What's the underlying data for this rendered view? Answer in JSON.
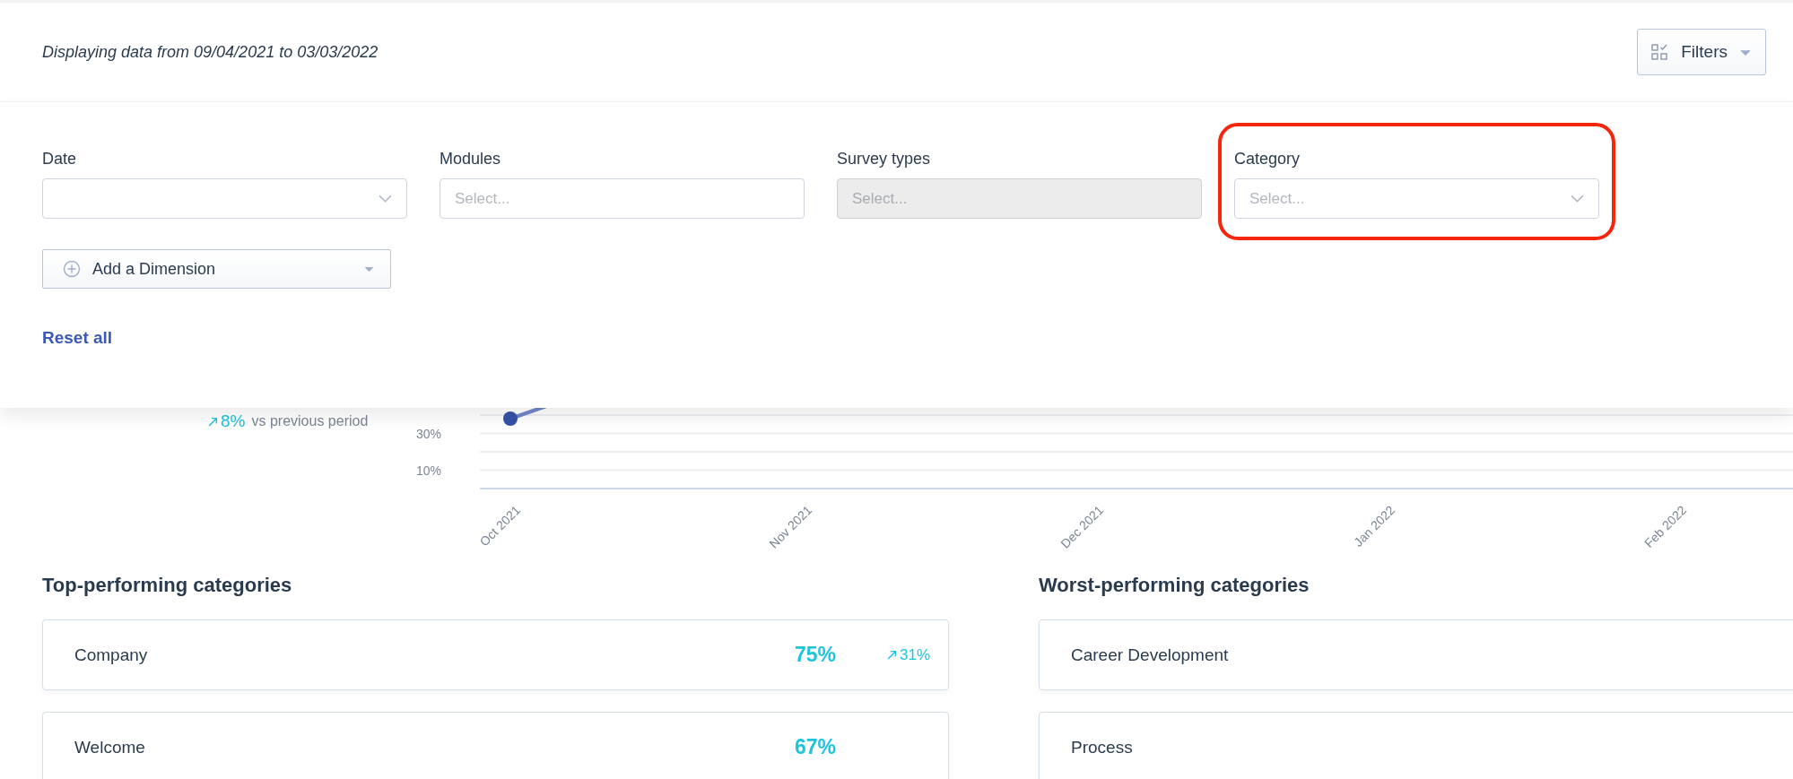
{
  "header": {
    "date_range": "Displaying data from 09/04/2021 to 03/03/2022",
    "filters_button": "Filters"
  },
  "filter_panel": {
    "fields": [
      {
        "label": "Date",
        "kind": "dropdown",
        "disabled": false,
        "highlighted": false
      },
      {
        "label": "Modules",
        "kind": "input",
        "placeholder": "Select...",
        "disabled": false,
        "highlighted": false
      },
      {
        "label": "Survey types",
        "kind": "input",
        "placeholder": "Select...",
        "disabled": true,
        "highlighted": false
      },
      {
        "label": "Category",
        "kind": "dropdown",
        "placeholder": "Select...",
        "disabled": false,
        "highlighted": true
      }
    ],
    "add_dimension": "Add a Dimension",
    "reset": "Reset all"
  },
  "kpi": {
    "change": "8%",
    "change_label": "vs previous period"
  },
  "chart": {
    "y_labels": [
      "30%",
      "10%"
    ],
    "x_labels": [
      "Oct 2021",
      "Nov 2021",
      "Dec 2021",
      "Jan 2022",
      "Feb 2022"
    ]
  },
  "top_categories": {
    "title": "Top-performing categories",
    "items": [
      {
        "name": "Company",
        "score": "75%",
        "change": "31%"
      },
      {
        "name": "Welcome",
        "score": "67%"
      }
    ]
  },
  "worst_categories": {
    "title": "Worst-performing categories",
    "items": [
      {
        "name": "Career Development"
      },
      {
        "name": "Process"
      }
    ]
  }
}
